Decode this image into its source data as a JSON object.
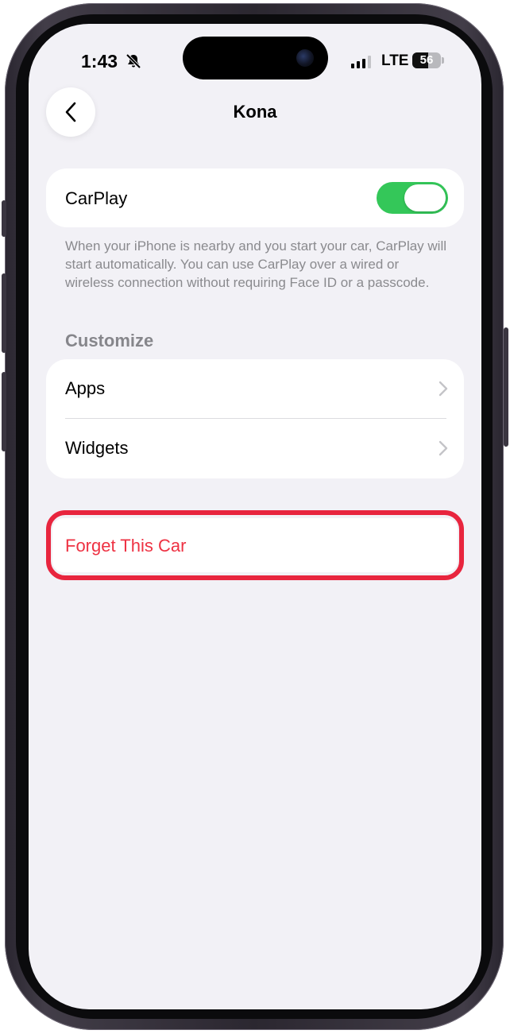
{
  "status_bar": {
    "time": "1:43",
    "network": "LTE",
    "battery": "56",
    "battery_level": 0.56
  },
  "nav": {
    "title": "Kona",
    "back_icon": "chevron-left-icon"
  },
  "carplay": {
    "label": "CarPlay",
    "enabled": true,
    "footnote": "When your iPhone is nearby and you start your car, CarPlay will start automatically. You can use CarPlay over a wired or wireless connection without requiring Face ID or a passcode."
  },
  "customize": {
    "header": "Customize",
    "items": [
      {
        "label": "Apps"
      },
      {
        "label": "Widgets"
      }
    ]
  },
  "forget": {
    "label": "Forget This Car"
  },
  "colors": {
    "toggle_on": "#34c759",
    "destructive": "#ee3243",
    "highlight": "#e8253e",
    "background": "#f2f1f6"
  }
}
